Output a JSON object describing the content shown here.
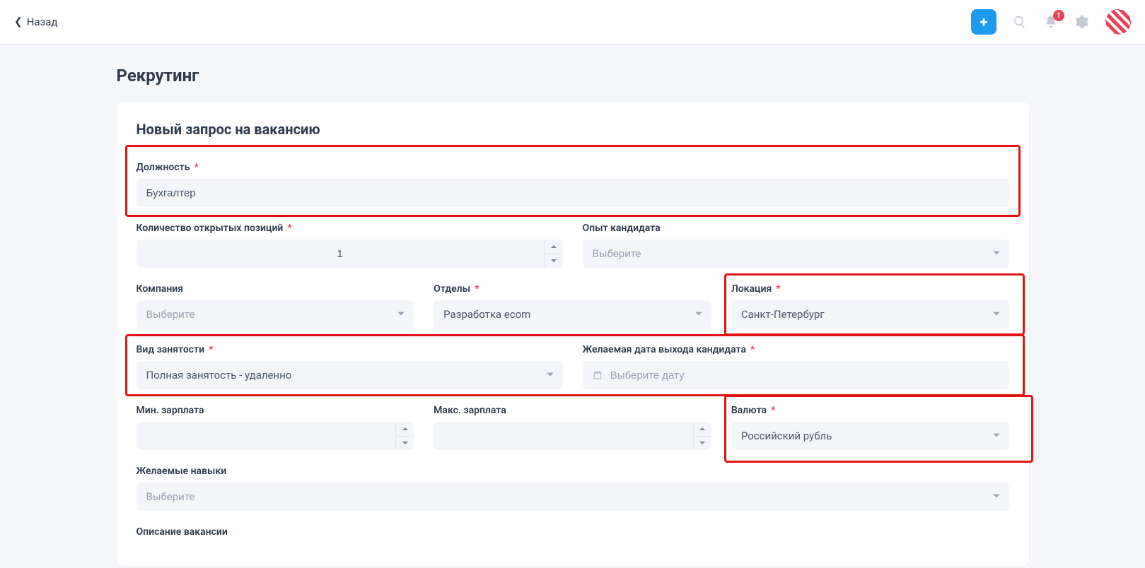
{
  "header": {
    "back_label": "Назад",
    "notifications_count": "1"
  },
  "page": {
    "title": "Рекрутинг",
    "card_title": "Новый запрос на вакансию"
  },
  "fields": {
    "position": {
      "label": "Должность",
      "value": "Бухгалтер"
    },
    "open_count": {
      "label": "Количество открытых позиций",
      "value": "1"
    },
    "experience": {
      "label": "Опыт кандидата",
      "placeholder": "Выберите"
    },
    "company": {
      "label": "Компания",
      "placeholder": "Выберите"
    },
    "departments": {
      "label": "Отделы",
      "value": "Разработка ecom"
    },
    "location": {
      "label": "Локация",
      "value": "Санкт-Петербург"
    },
    "employment": {
      "label": "Вид занятости",
      "value": "Полная занятость - удаленно"
    },
    "start_date": {
      "label": "Желаемая дата выхода кандидата",
      "placeholder": "Выберите дату"
    },
    "min_salary": {
      "label": "Мин. зарплата"
    },
    "max_salary": {
      "label": "Макс. зарплата"
    },
    "currency": {
      "label": "Валюта",
      "value": "Российский рубль"
    },
    "skills": {
      "label": "Желаемые навыки",
      "placeholder": "Выберите"
    },
    "description": {
      "label": "Описание вакансии"
    }
  }
}
